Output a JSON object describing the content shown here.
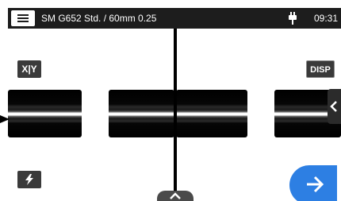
{
  "header": {
    "title": "SM G652 Std. / 60mm 0.25",
    "time": "09:31",
    "menu_icon": "hamburger-menu-icon",
    "power_icon": "plug-icon"
  },
  "controls": {
    "xy_label": "X|Y",
    "disp_label": "DISP",
    "side_tab_icon": "chevron-left-icon",
    "arc_icon": "lightning-icon",
    "next_icon": "arrow-right-icon",
    "handle_icon": "chevron-up-icon"
  },
  "colors": {
    "header_bg": "#1d1d1d",
    "button_bg": "#3a3a3a",
    "next_button": "#2d7fe3"
  }
}
